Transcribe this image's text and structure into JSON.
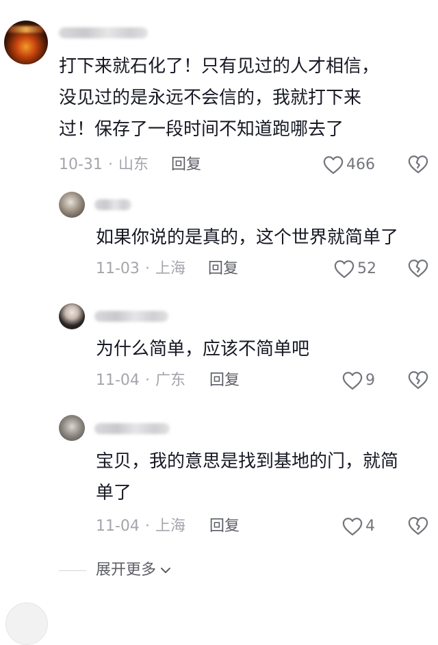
{
  "comments": [
    {
      "text": "打下来就石化了！只有见过的人才相信，\n没见过的是永远不会信的，我就打下来\n过！保存了一段时间不知道跑哪去了",
      "date": "10-31",
      "location": "山东",
      "reply_label": "回复",
      "likes": "466"
    },
    {
      "text": "如果你说的是真的，这个世界就简单了",
      "date": "11-03",
      "location": "上海",
      "reply_label": "回复",
      "likes": "52"
    },
    {
      "text": "为什么简单，应该不简单吧",
      "date": "11-04",
      "location": "广东",
      "reply_label": "回复",
      "likes": "9"
    },
    {
      "text": "宝贝，我的意思是找到基地的门，就简\n单了",
      "date": "11-04",
      "location": "上海",
      "reply_label": "回复",
      "likes": "4"
    }
  ],
  "separator": "·",
  "expand_label": "展开更多",
  "icons": {
    "like": "heart-outline-icon",
    "dislike": "broken-heart-icon",
    "expand": "chevron-down-icon"
  },
  "colors": {
    "text": "#161823",
    "meta": "#a3a5ab",
    "icon": "#73757d"
  }
}
